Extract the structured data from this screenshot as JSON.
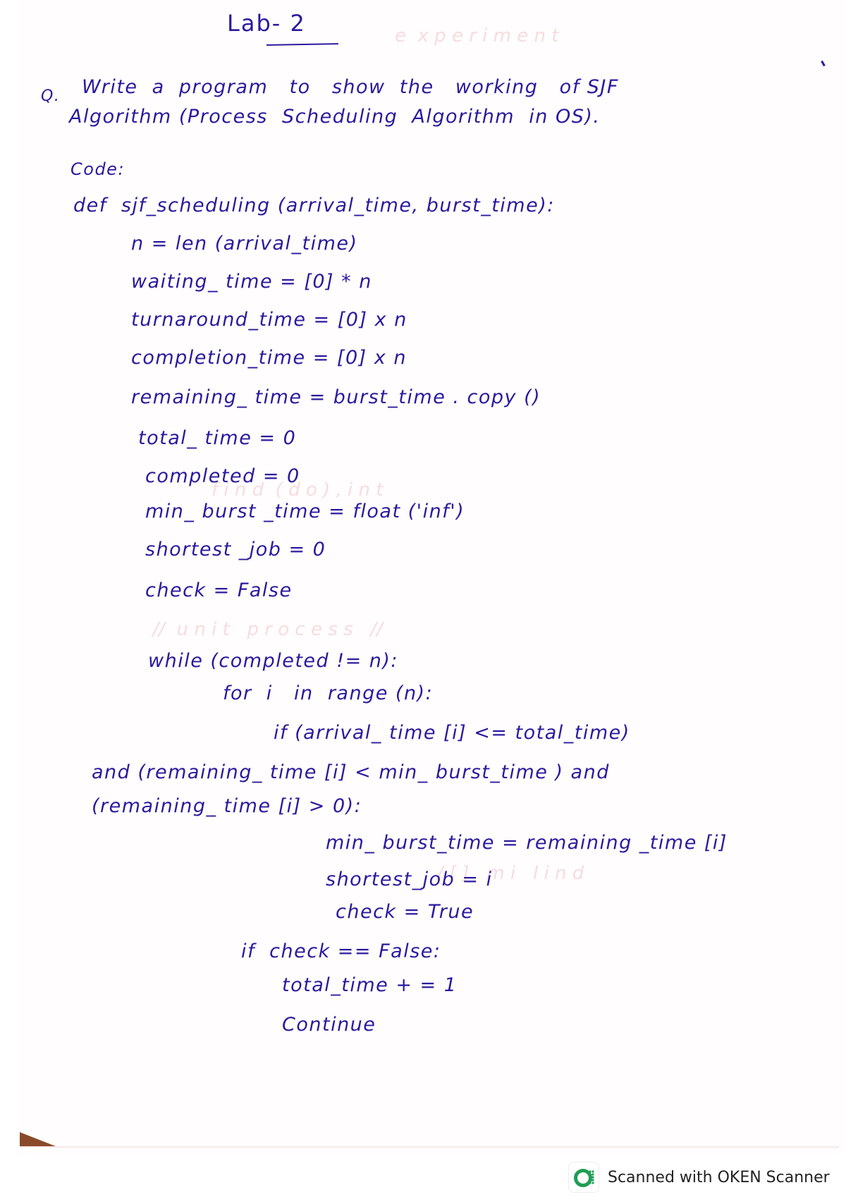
{
  "document": {
    "title": "Lab- 2",
    "question_marker": "Q.",
    "question_line1": "Write  a  program   to   show  the   working   of SJF",
    "question_line2": "Algorithm (Process  Scheduling  Algorithm  in OS).",
    "code_label": "Code:",
    "code_lines": [
      "def  sjf_scheduling (arrival_time, burst_time):",
      "n = len (arrival_time)",
      "waiting_ time = [0] * n",
      "turnaround_time = [0] x n",
      "completion_time = [0] x n",
      "remaining_ time = burst_time . copy ()",
      "total_ time = 0",
      "completed = 0",
      "min_ burst _time = float ('inf')",
      "shortest _job = 0",
      "check = False",
      "while (completed != n):",
      "for  i   in  range (n):",
      "if (arrival_ time [i] <= total_time)",
      "and (remaining_ time [i] < min_ burst_time ) and",
      "(remaining_ time [i] > 0):",
      "min_ burst_time = remaining _time [i]",
      "shortest_job = i",
      "check = True",
      "if  check == False:",
      "total_time + = 1",
      "Continue"
    ]
  },
  "watermark": {
    "text": "Scanned with OKEN Scanner",
    "logo_icon": "oken-scanner-logo",
    "accent_color": "#1f9d55"
  },
  "ink_color": "#2a1a9e"
}
